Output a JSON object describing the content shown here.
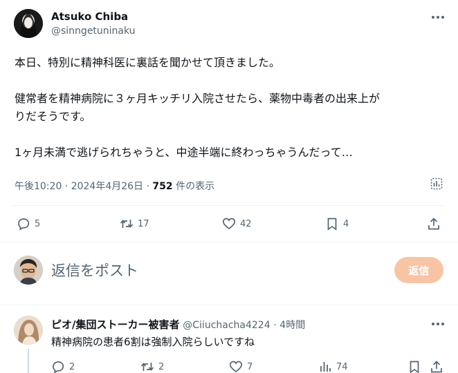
{
  "post": {
    "author_name": "Atsuko Chiba",
    "author_handle": "@sinngetuninaku",
    "line1": "本日、特別に精神科医に裏話を聞かせて頂きました。",
    "line2": "健常者を精神病院に３ヶ月キッチリ入院させたら、薬物中毒者の出来上が",
    "line3": "りだそうです。",
    "line4": "1ヶ月未満で逃げられちゃうと、中途半端に終わっちゃうんだって…",
    "meta_time": "午後10:20 · 2024年4月26日 · ",
    "meta_views": "752",
    "meta_views_suffix": " 件の表示",
    "actions": {
      "reply_count": "5",
      "repost_count": "17",
      "like_count": "42",
      "bookmark_count": "4"
    }
  },
  "composer": {
    "placeholder": "返信をポスト",
    "reply_button": "返信"
  },
  "reply": {
    "author_name": "ピオ/集団ストーカー被害者",
    "author_handle": "@Ciiuchacha4224",
    "time": "· 4時間",
    "text": "精神病院の患者6割は強制入院らしいですね",
    "actions": {
      "reply_count": "2",
      "repost_count": "2",
      "like_count": "7",
      "views_count": "74"
    }
  },
  "colors": {
    "text": "#0f1419",
    "muted": "#536471",
    "reply_button_bg": "#f7c5a5",
    "divider": "#eff3f4"
  }
}
